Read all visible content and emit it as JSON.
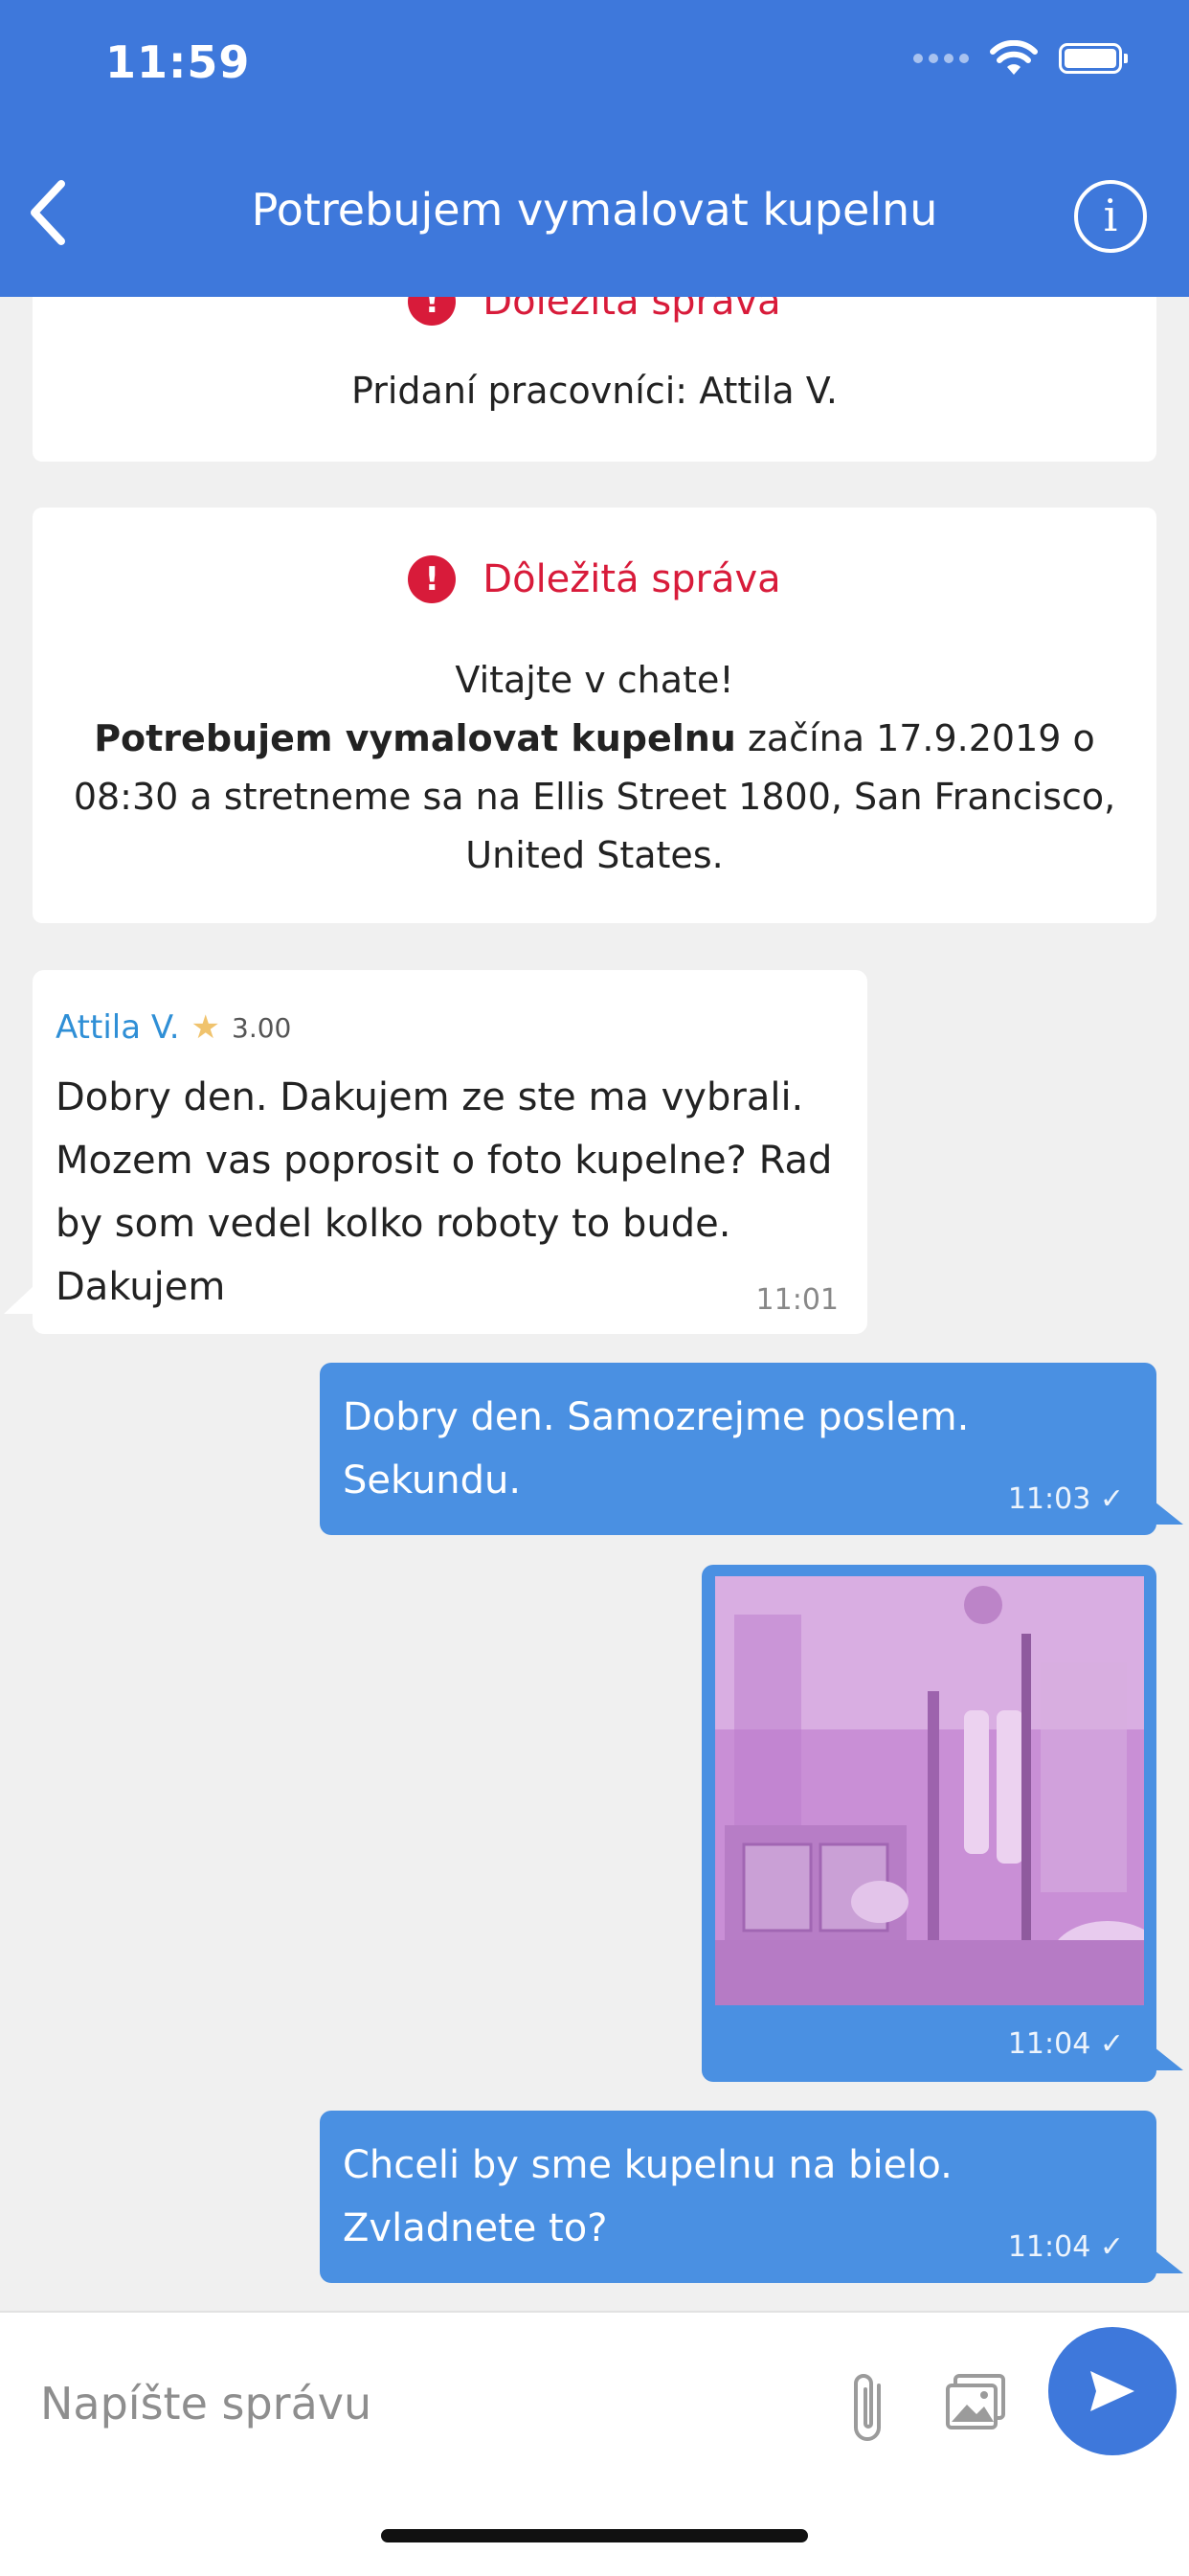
{
  "status_bar": {
    "time": "11:59"
  },
  "header": {
    "title": "Potrebujem vymalovat kupelnu"
  },
  "notice_card_partial": {
    "title": "Dôležitá správa",
    "text": "Pridaní pracovníci: Attila V."
  },
  "notice_card": {
    "title": "Dôležitá správa",
    "line1": "Vitajte v chate!",
    "bold": "Potrebujem vymalovat kupelnu",
    "line2_rest": " začína 17.9.2019 o",
    "line3": "08:30 a stretneme sa na Ellis Street 1800, San Francisco,",
    "line4": "United States."
  },
  "messages": [
    {
      "direction": "incoming",
      "sender": "Attila V.",
      "rating": "3.00",
      "lines": [
        "Dobry den. Dakujem ze ste ma vybrali.",
        "Mozem vas poprosit o foto kupelne? Rad",
        "by som vedel kolko roboty to bude.",
        "Dakujem"
      ],
      "time": "11:01"
    },
    {
      "direction": "outgoing",
      "lines": [
        "Dobry den. Samozrejme poslem.",
        "Sekundu."
      ],
      "time": "11:03"
    },
    {
      "direction": "outgoing",
      "type": "image",
      "time": "11:04"
    },
    {
      "direction": "outgoing",
      "lines": [
        "Chceli by sme kupelnu na bielo.",
        "Zvladnete to?"
      ],
      "time": "11:04"
    }
  ],
  "composer": {
    "placeholder": "Napíšte správu"
  },
  "colors": {
    "header": "#3e78db",
    "outgoing_bubble": "#4a90e2",
    "alert": "#d81b3a",
    "sender_name": "#2f8fd6"
  },
  "icons": [
    "back-chevron-icon",
    "info-icon",
    "alert-icon",
    "star-icon",
    "checkmark-icon",
    "paperclip-icon",
    "gallery-icon",
    "send-icon",
    "wifi-icon",
    "battery-icon",
    "signal-dots-icon"
  ]
}
